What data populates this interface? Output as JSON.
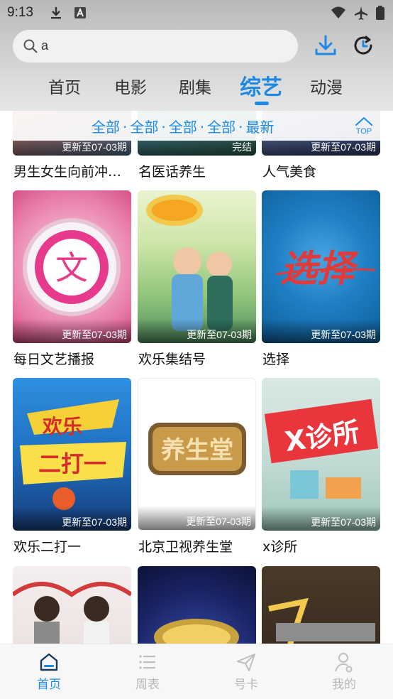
{
  "status_bar": {
    "time": "9:13"
  },
  "search": {
    "value": "a"
  },
  "tabs": [
    {
      "label": "首页"
    },
    {
      "label": "电影"
    },
    {
      "label": "剧集"
    },
    {
      "label": "综艺",
      "active": true
    },
    {
      "label": "动漫"
    }
  ],
  "filters": {
    "items": [
      "全部",
      "全部",
      "全部",
      "全部",
      "最新"
    ],
    "separator": "·",
    "top_label": "TOP"
  },
  "rows": [
    [
      {
        "title": "男生女生向前冲…",
        "badge": "更新至07-03期"
      },
      {
        "title": "名医话养生",
        "badge": "完结"
      },
      {
        "title": "人气美食",
        "badge": "更新至07-03期"
      }
    ],
    [
      {
        "title": "每日文艺播报",
        "badge": "更新至07-03期"
      },
      {
        "title": "欢乐集结号",
        "badge": "更新至07-03期"
      },
      {
        "title": "选择",
        "badge": "更新至07-03期"
      }
    ],
    [
      {
        "title": "欢乐二打一",
        "badge": "更新至07-03期"
      },
      {
        "title": "北京卫视养生堂",
        "badge": "更新至07-03期"
      },
      {
        "title": "x诊所",
        "badge": "更新至07-03期"
      }
    ]
  ],
  "poster_texts": {
    "wenyi": "文",
    "xuanze": "选择",
    "huanle": "欢乐",
    "erdayi": "二打一",
    "yangshengtang": "养生堂",
    "xzhensuo": "X诊所"
  },
  "bottom_nav": [
    {
      "label": "首页",
      "active": true
    },
    {
      "label": "周表"
    },
    {
      "label": "号卡"
    },
    {
      "label": "我的"
    }
  ],
  "colors": {
    "accent": "#1e88e5",
    "inactive": "#b8b8b8"
  }
}
